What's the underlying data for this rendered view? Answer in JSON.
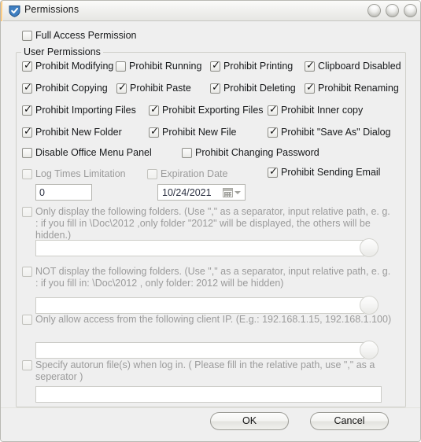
{
  "window": {
    "title": "Permissions",
    "icon": "shield-check-icon",
    "controls": [
      "minimize-button",
      "maximize-button",
      "close-button"
    ],
    "bg_color": "#efefef",
    "accent_color": "#3f7fc1"
  },
  "full_access": {
    "label": "Full Access Permission",
    "checked": false
  },
  "group": {
    "legend": "User Permissions",
    "rows": [
      [
        {
          "label": "Prohibit Modifying",
          "checked": true,
          "disabled": false
        },
        {
          "label": "Prohibit Running",
          "checked": false,
          "disabled": false
        },
        {
          "label": "Prohibit Printing",
          "checked": true,
          "disabled": false
        },
        {
          "label": "Clipboard Disabled",
          "checked": true,
          "disabled": false
        }
      ],
      [
        {
          "label": "Prohibit Copying",
          "checked": true,
          "disabled": false
        },
        {
          "label": "Prohibit Paste",
          "checked": true,
          "disabled": false
        },
        {
          "label": "Prohibit Deleting",
          "checked": true,
          "disabled": false
        },
        {
          "label": "Prohibit Renaming",
          "checked": true,
          "disabled": false
        }
      ],
      [
        {
          "label": "Prohibit Importing Files",
          "checked": true,
          "disabled": false
        },
        {
          "label": "Prohibit Exporting Files",
          "checked": true,
          "disabled": false
        },
        {
          "label": "Prohibit Inner copy",
          "checked": true,
          "disabled": false
        }
      ],
      [
        {
          "label": "Prohibit New Folder",
          "checked": true,
          "disabled": false
        },
        {
          "label": "Prohibit New File",
          "checked": true,
          "disabled": false
        },
        {
          "label": "Prohibit \"Save As\" Dialog",
          "checked": true,
          "disabled": false
        }
      ]
    ],
    "office_row": [
      {
        "label": "Disable Office Menu Panel",
        "checked": false,
        "disabled": false
      },
      {
        "label": "Prohibit Changing Password",
        "checked": false,
        "disabled": false
      }
    ],
    "log_row": [
      {
        "label": "Log Times Limitation",
        "checked": false,
        "disabled": true
      },
      {
        "label": "Expiration Date",
        "checked": false,
        "disabled": true
      },
      {
        "label": "Prohibit Sending Email",
        "checked": true,
        "disabled": false
      }
    ],
    "log_times_value": "0",
    "expiration_date_value": "10/24/2021",
    "blocks": [
      {
        "label": "Only display the following folders. (Use \",\" as a separator, input relative path,  e. g. : if you fill in \\Doc\\2012 ,only folder \"2012\" will be displayed, the others will be hidden.)",
        "checked": false,
        "disabled": true,
        "value": "",
        "has_round_button": true
      },
      {
        "label": "NOT display the following folders. (Use \",\" as a separator, input relative path,  e. g. : if you fill in: \\Doc\\2012 , only folder: 2012 will be hidden)",
        "checked": false,
        "disabled": true,
        "value": "",
        "has_round_button": true
      },
      {
        "label": "Only allow access from the following client IP. (E.g.: 192.168.1.15, 192.168.1.100)",
        "checked": false,
        "disabled": true,
        "value": "",
        "has_round_button": true
      },
      {
        "label": "Specify autorun file(s) when log in. ( Please fill in the relative path, use \",\" as a seperator )",
        "checked": false,
        "disabled": true,
        "value": "",
        "has_round_button": false
      }
    ]
  },
  "footer": {
    "ok_label": "OK",
    "cancel_label": "Cancel"
  }
}
